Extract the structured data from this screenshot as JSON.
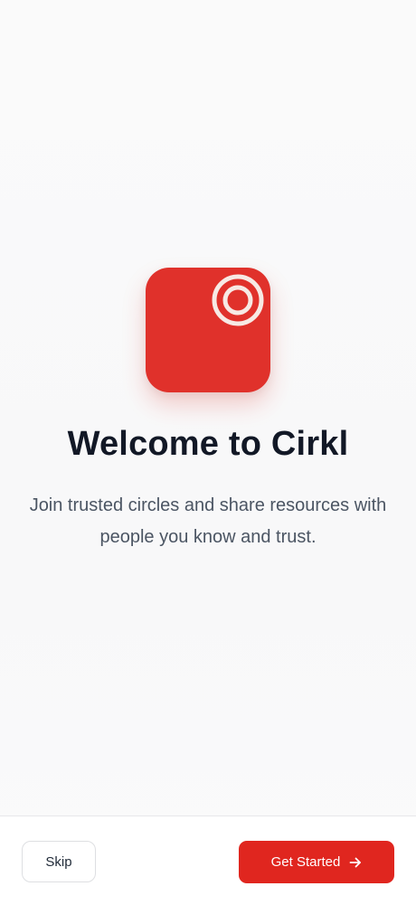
{
  "welcome": {
    "app_icon": "circle-target-logo",
    "title": "Welcome to Cirkl",
    "subtitle": "Join trusted circles and share resources with people you know and trust."
  },
  "footer": {
    "skip_label": "Skip",
    "start_label": "Get Started",
    "start_icon": "arrow-right-icon"
  },
  "colors": {
    "brand": "#e0312b",
    "button_primary": "#e0261f",
    "title_text": "#121826",
    "body_text": "#4b5563",
    "logo_ring": "#f7e9e4"
  }
}
